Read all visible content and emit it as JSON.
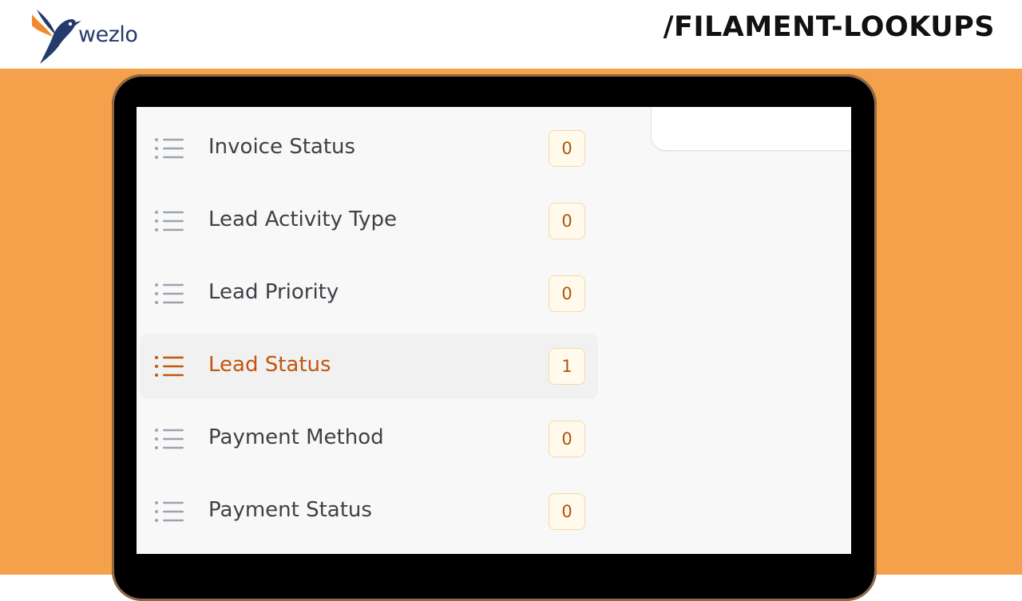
{
  "brand": {
    "logo_text": "wezlo",
    "title": "/FILAMENT-LOOKUPS"
  },
  "colors": {
    "stage_bg": "#f5a04a",
    "active_text": "#c2560c",
    "badge_text": "#b45309"
  },
  "nav": {
    "items": [
      {
        "label": "Invoice Status",
        "count": "0",
        "active": false,
        "icon": "list-icon"
      },
      {
        "label": "Lead Activity Type",
        "count": "0",
        "active": false,
        "icon": "list-icon"
      },
      {
        "label": "Lead Priority",
        "count": "0",
        "active": false,
        "icon": "list-icon"
      },
      {
        "label": "Lead Status",
        "count": "1",
        "active": true,
        "icon": "list-icon"
      },
      {
        "label": "Payment Method",
        "count": "0",
        "active": false,
        "icon": "list-icon"
      },
      {
        "label": "Payment Status",
        "count": "0",
        "active": false,
        "icon": "list-icon"
      }
    ]
  }
}
